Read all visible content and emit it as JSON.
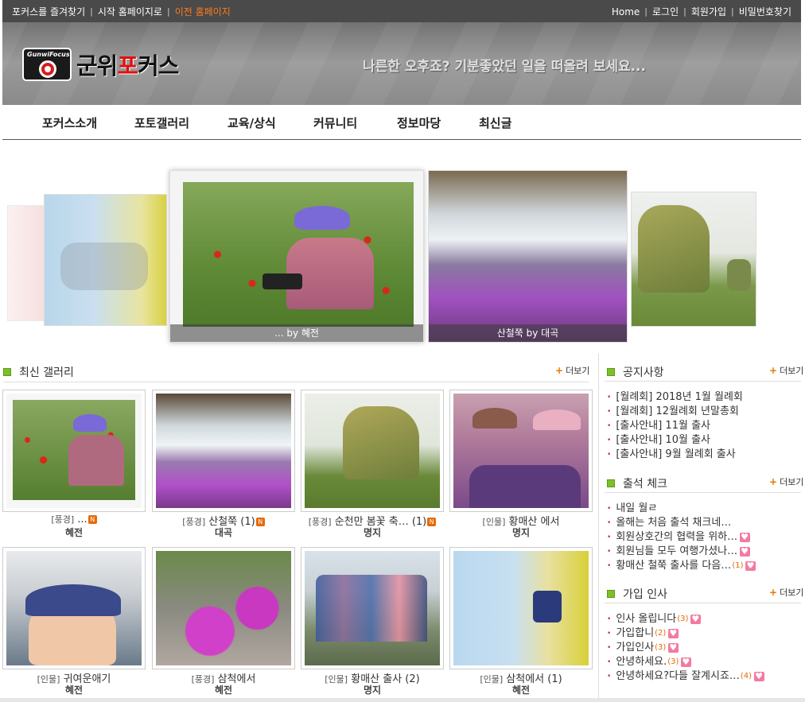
{
  "topbar": {
    "left_links": [
      "포커스를 즐겨찾기",
      "시작 홈페이지로",
      "이전 홈페이지"
    ],
    "right_links": [
      "Home",
      "로그인",
      "회원가입",
      "비밀번호찾기"
    ]
  },
  "header": {
    "logo_brand": "GunwiFocus",
    "logo_text_1": "군위",
    "logo_text_2": "포",
    "logo_text_3": "커스",
    "slogan": "나른한 오후죠? 기분좋았던 일을 떠올려 보세요..."
  },
  "nav": [
    "포커스소개",
    "포토갤러리",
    "교육/상식",
    "커뮤니티",
    "정보마당",
    "최신글"
  ],
  "slider": {
    "captions": [
      "... by 혜전",
      "산철쭉 by 대곡"
    ]
  },
  "gallery": {
    "title": "최신 갤러리",
    "more": "더보기",
    "items": [
      {
        "cat": "[풍경]",
        "title": "...",
        "author": "혜전",
        "new": "N"
      },
      {
        "cat": "[풍경]",
        "title": "산철쭉 (1)",
        "author": "대곡",
        "new": "N"
      },
      {
        "cat": "[풍경]",
        "title": "순천만 봄꽃 축… (1)",
        "author": "명지",
        "new": "N"
      },
      {
        "cat": "[인물]",
        "title": "황매산 에서",
        "author": "명지",
        "new": ""
      },
      {
        "cat": "[인물]",
        "title": "귀여운애기",
        "author": "혜전",
        "new": ""
      },
      {
        "cat": "[풍경]",
        "title": "삼척에서",
        "author": "혜전",
        "new": ""
      },
      {
        "cat": "[인물]",
        "title": "황매산 출사 (2)",
        "author": "명지",
        "new": ""
      },
      {
        "cat": "[인물]",
        "title": "삼척에서 (1)",
        "author": "혜전",
        "new": ""
      }
    ]
  },
  "notice": {
    "title": "공지사항",
    "more": "더보기",
    "items": [
      "[월례회] 2018년 1월 월례회",
      "[월례회] 12월례회 년말총회",
      "[출사안내] 11월 출사",
      "[출사안내] 10월 출사",
      "[출사안내] 9월 월례회 출사"
    ]
  },
  "attendance": {
    "title": "출석 체크",
    "more": "더보기",
    "items": [
      {
        "text": "내일 월ㄹ",
        "count": "",
        "heart": false
      },
      {
        "text": "올해는 처음 출석 채크네…",
        "count": "",
        "heart": false
      },
      {
        "text": "회원상호간의 협력을 위하…",
        "count": "",
        "heart": true
      },
      {
        "text": "회원님들 모두 여행가셨나…",
        "count": "",
        "heart": true
      },
      {
        "text": "황매산 철쭉 출사를 다음…",
        "count": "(1)",
        "heart": true
      }
    ]
  },
  "greeting": {
    "title": "가입 인사",
    "more": "더보기",
    "items": [
      {
        "text": "인사 올립니다",
        "count": "(3)",
        "heart": true
      },
      {
        "text": "가입합니",
        "count": "(2)",
        "heart": true
      },
      {
        "text": "가입인사",
        "count": "(3)",
        "heart": true
      },
      {
        "text": "안녕하세요.",
        "count": "(3)",
        "heart": true
      },
      {
        "text": "안녕하세요?다들 잘계시죠…",
        "count": "(4)",
        "heart": true
      }
    ]
  }
}
